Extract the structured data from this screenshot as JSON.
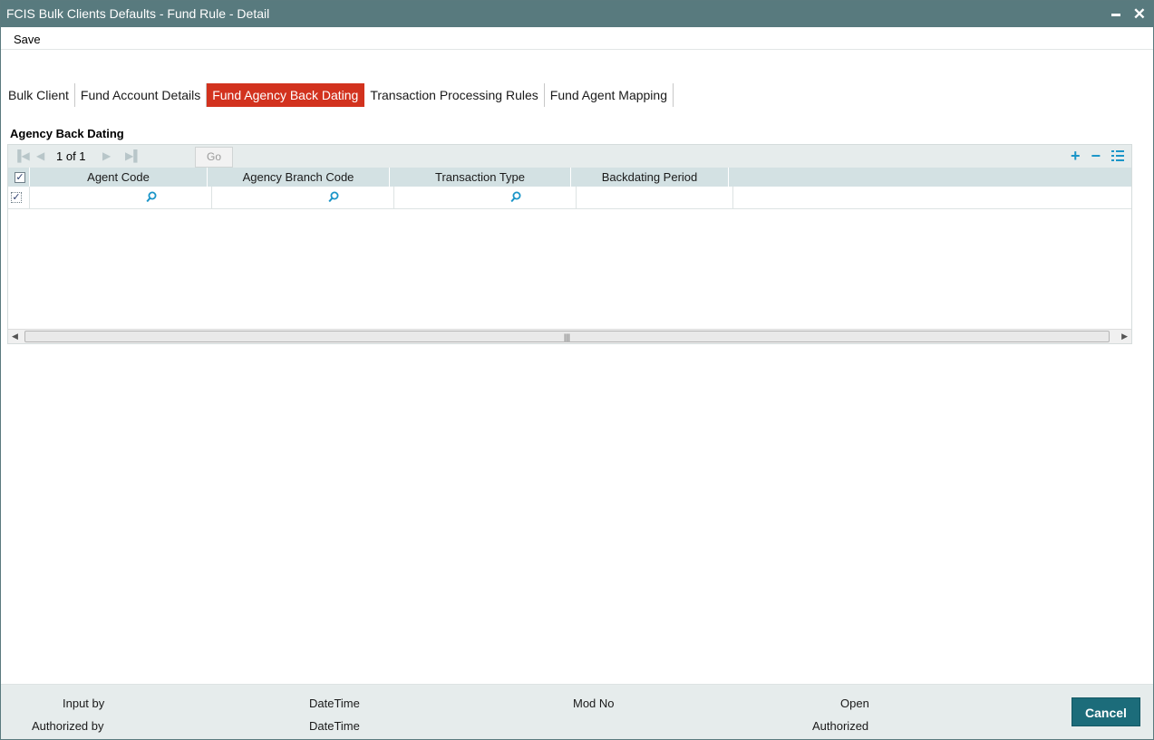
{
  "window": {
    "title": "FCIS Bulk Clients Defaults - Fund Rule - Detail"
  },
  "menu": {
    "save_label": "Save"
  },
  "tabs": [
    {
      "label": "Bulk Client",
      "active": false
    },
    {
      "label": "Fund Account Details",
      "active": false
    },
    {
      "label": "Fund Agency Back Dating",
      "active": true
    },
    {
      "label": "Transaction Processing Rules",
      "active": false
    },
    {
      "label": "Fund Agent Mapping",
      "active": false
    }
  ],
  "section": {
    "title": "Agency Back Dating"
  },
  "grid": {
    "pager": {
      "page_text": "1 of 1",
      "go_label": "Go"
    },
    "columns": [
      "Agent Code",
      "Agency Branch Code",
      "Transaction Type",
      "Backdating Period"
    ],
    "rows": [
      {
        "checked": true,
        "agent_code": "",
        "agency_branch_code": "",
        "transaction_type": "",
        "backdating_period": ""
      }
    ],
    "header_checked": true
  },
  "footer": {
    "input_by_label": "Input by",
    "datetime_label_1": "DateTime",
    "mod_no_label": "Mod No",
    "open_label": "Open",
    "authorized_by_label": "Authorized by",
    "datetime_label_2": "DateTime",
    "authorized_label": "Authorized",
    "cancel_label": "Cancel"
  },
  "colors": {
    "titlebar": "#587a7e",
    "active_tab": "#d2321e",
    "accent": "#1a95c8",
    "cancel_button": "#1c6c7a"
  }
}
